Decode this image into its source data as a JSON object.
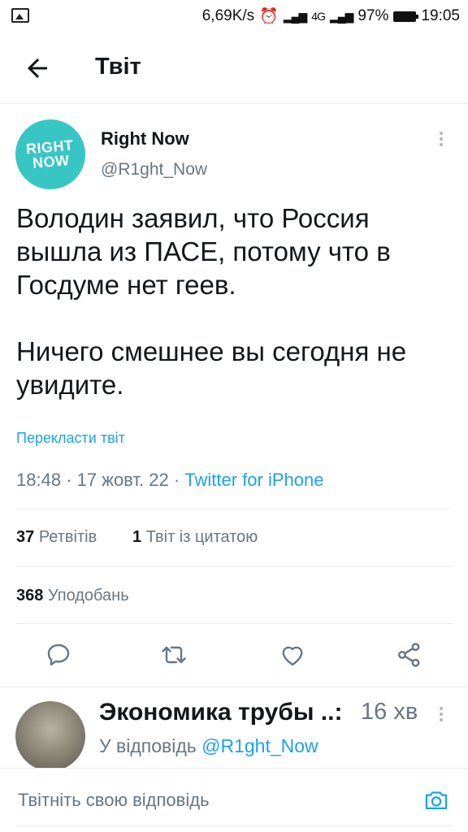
{
  "status_bar": {
    "speed": "6,69K/s",
    "signal": "4G",
    "battery": "97%",
    "time": "19:05"
  },
  "header": {
    "title": "Твіт"
  },
  "tweet": {
    "author_name": "Right Now",
    "author_handle": "@R1ght_Now",
    "avatar_text": "RIGHT NOW",
    "text_p1": "Володин заявил, что Россия вышла из ПАСЕ, потому что в Госдуме нет геев.",
    "text_p2": "Ничего смешнее вы сегодня не увидите.",
    "translate_label": "Перекласти твіт",
    "time": "18:48",
    "date": "17 жовт. 22",
    "source": "Twitter for iPhone",
    "retweets_count": "37",
    "retweets_label": "Ретвітів",
    "quotes_count": "1",
    "quotes_label": "Твіт із цитатою",
    "likes_count": "368",
    "likes_label": "Уподобань"
  },
  "reply": {
    "author_name": "Экономика трубы",
    "time_ago": "16 хв",
    "reply_prefix": "У відповідь",
    "mention": "@R1ght_Now"
  },
  "compose": {
    "placeholder": "Твітніть свою відповідь"
  },
  "colors": {
    "accent": "#1da1f2",
    "muted": "#657786",
    "avatar_bg": "#37c6c4"
  },
  "icons": [
    "back-arrow-icon",
    "more-icon",
    "reply-icon",
    "retweet-icon",
    "like-icon",
    "share-icon",
    "camera-icon"
  ]
}
